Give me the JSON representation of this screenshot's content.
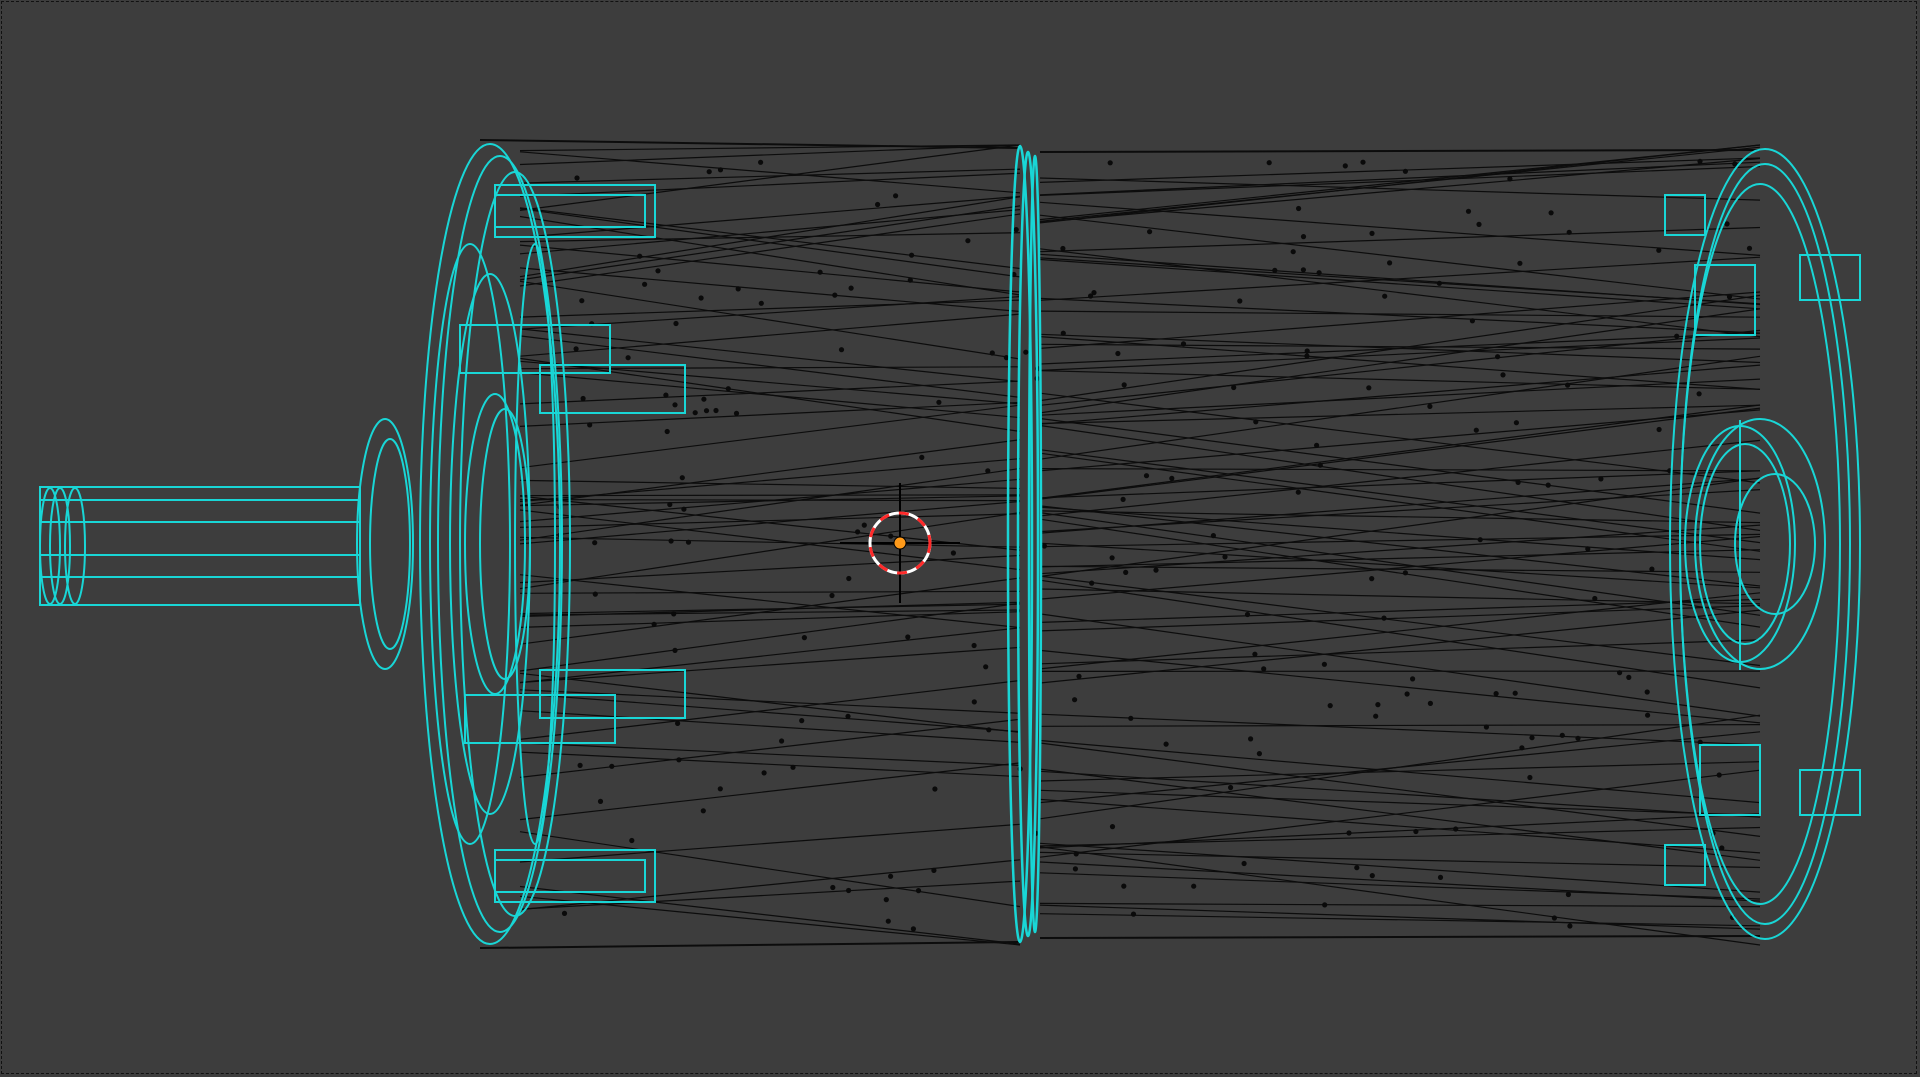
{
  "app": {
    "view": "3D viewport",
    "display_mode": "wireframe",
    "background_color": "#3d3d3d"
  },
  "scene": {
    "object": {
      "kind": "cylindrical motor mesh (wireframe)",
      "wire_color": "#000000",
      "selected_edge_color": "#19d6d6",
      "vertex_color": "#000000"
    },
    "cursor": {
      "icon": "3d-cursor-icon",
      "ring_color_a": "#ff2a2a",
      "ring_color_b": "#ffffff",
      "origin_color": "#ff9a1a"
    }
  }
}
